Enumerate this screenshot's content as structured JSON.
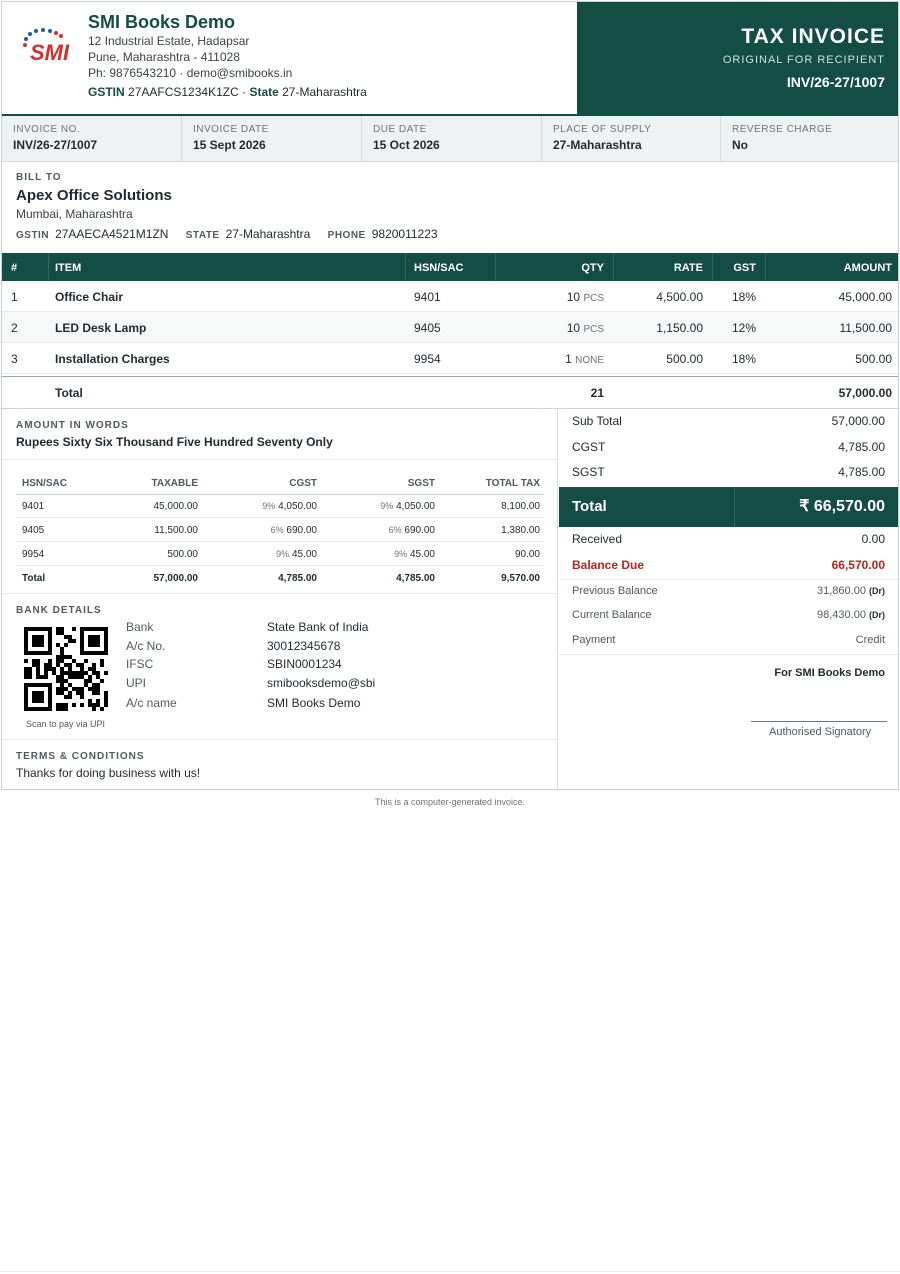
{
  "company": {
    "name": "SMI Books Demo",
    "address1": "12 Industrial Estate, Hadapsar",
    "address2": "Pune, Maharashtra - 411028",
    "contact": "Ph: 9876543210 · demo@smibooks.in",
    "gstin_label": "GSTIN",
    "gstin": "27AAFCS1234K1ZC",
    "state_label": "State",
    "state": "27-Maharashtra",
    "logo_text": "SMI"
  },
  "doc": {
    "title": "TAX INVOICE",
    "subtitle": "ORIGINAL FOR RECIPIENT",
    "number": "INV/26-27/1007"
  },
  "meta": [
    {
      "label": "INVOICE NO.",
      "value": "INV/26-27/1007"
    },
    {
      "label": "INVOICE DATE",
      "value": "15 Sept 2026"
    },
    {
      "label": "DUE DATE",
      "value": "15 Oct 2026"
    },
    {
      "label": "PLACE OF SUPPLY",
      "value": "27-Maharashtra"
    },
    {
      "label": "REVERSE CHARGE",
      "value": "No"
    }
  ],
  "bill_to": {
    "label": "BILL TO",
    "name": "Apex Office Solutions",
    "address": "Mumbai, Maharashtra",
    "gstin_label": "GSTIN",
    "gstin": "27AAECA4521M1ZN",
    "state_label": "STATE",
    "state": "27-Maharashtra",
    "phone_label": "PHONE",
    "phone": "9820011223"
  },
  "items": {
    "headers": {
      "num": "#",
      "item": "ITEM",
      "hsn": "HSN/SAC",
      "qty": "QTY",
      "rate": "RATE",
      "gst": "GST",
      "amount": "AMOUNT"
    },
    "rows": [
      {
        "num": "1",
        "item": "Office Chair",
        "hsn": "9401",
        "qty": "10",
        "unit": "PCS",
        "rate": "4,500.00",
        "gst": "18%",
        "amount": "45,000.00"
      },
      {
        "num": "2",
        "item": "LED Desk Lamp",
        "hsn": "9405",
        "qty": "10",
        "unit": "PCS",
        "rate": "1,150.00",
        "gst": "12%",
        "amount": "11,500.00"
      },
      {
        "num": "3",
        "item": "Installation Charges",
        "hsn": "9954",
        "qty": "1",
        "unit": "NONE",
        "rate": "500.00",
        "gst": "18%",
        "amount": "500.00"
      }
    ],
    "total": {
      "label": "Total",
      "qty": "21",
      "amount": "57,000.00"
    }
  },
  "amount_in_words": {
    "label": "AMOUNT IN WORDS",
    "text": "Rupees Sixty Six Thousand Five Hundred Seventy Only"
  },
  "hsn_summary": {
    "headers": {
      "hsn": "HSN/SAC",
      "taxable": "TAXABLE",
      "cgst": "CGST",
      "sgst": "SGST",
      "total": "TOTAL TAX"
    },
    "rows": [
      {
        "hsn": "9401",
        "taxable": "45,000.00",
        "cgst_pct": "9%",
        "cgst": "4,050.00",
        "sgst_pct": "9%",
        "sgst": "4,050.00",
        "total": "8,100.00"
      },
      {
        "hsn": "9405",
        "taxable": "11,500.00",
        "cgst_pct": "6%",
        "cgst": "690.00",
        "sgst_pct": "6%",
        "sgst": "690.00",
        "total": "1,380.00"
      },
      {
        "hsn": "9954",
        "taxable": "500.00",
        "cgst_pct": "9%",
        "cgst": "45.00",
        "sgst_pct": "9%",
        "sgst": "45.00",
        "total": "90.00"
      }
    ],
    "total": {
      "label": "Total",
      "taxable": "57,000.00",
      "cgst": "4,785.00",
      "sgst": "4,785.00",
      "total": "9,570.00"
    }
  },
  "bank": {
    "label": "BANK DETAILS",
    "qr_caption": "Scan to pay via UPI",
    "rows": [
      {
        "k": "Bank",
        "v": "State Bank of India"
      },
      {
        "k": "A/c No.",
        "v": "30012345678"
      },
      {
        "k": "IFSC",
        "v": "SBIN0001234"
      },
      {
        "k": "UPI",
        "v": "smibooksdemo@sbi"
      },
      {
        "k": "A/c name",
        "v": "SMI Books Demo"
      }
    ]
  },
  "terms": {
    "label": "TERMS & CONDITIONS",
    "text": "Thanks for doing business with us!"
  },
  "summary": {
    "sub_total_label": "Sub Total",
    "sub_total": "57,000.00",
    "cgst_label": "CGST",
    "cgst": "4,785.00",
    "sgst_label": "SGST",
    "sgst": "4,785.00",
    "total_label": "Total",
    "total": "₹ 66,570.00",
    "received_label": "Received",
    "received": "0.00",
    "balance_label": "Balance Due",
    "balance": "66,570.00",
    "prev_label": "Previous Balance",
    "prev": "31,860.00",
    "prev_suffix": "(Dr)",
    "curr_label": "Current Balance",
    "curr": "98,430.00",
    "curr_suffix": "(Dr)",
    "payment_label": "Payment",
    "payment": "Credit",
    "for_company": "For SMI Books Demo",
    "signatory": "Authorised Signatory"
  },
  "footer": {
    "note": "This is a computer-generated invoice."
  },
  "colors": {
    "brand": "#134d44",
    "balance": "#b3261e",
    "logo_red": "#d32f2f",
    "logo_blue": "#1e5aa8"
  }
}
